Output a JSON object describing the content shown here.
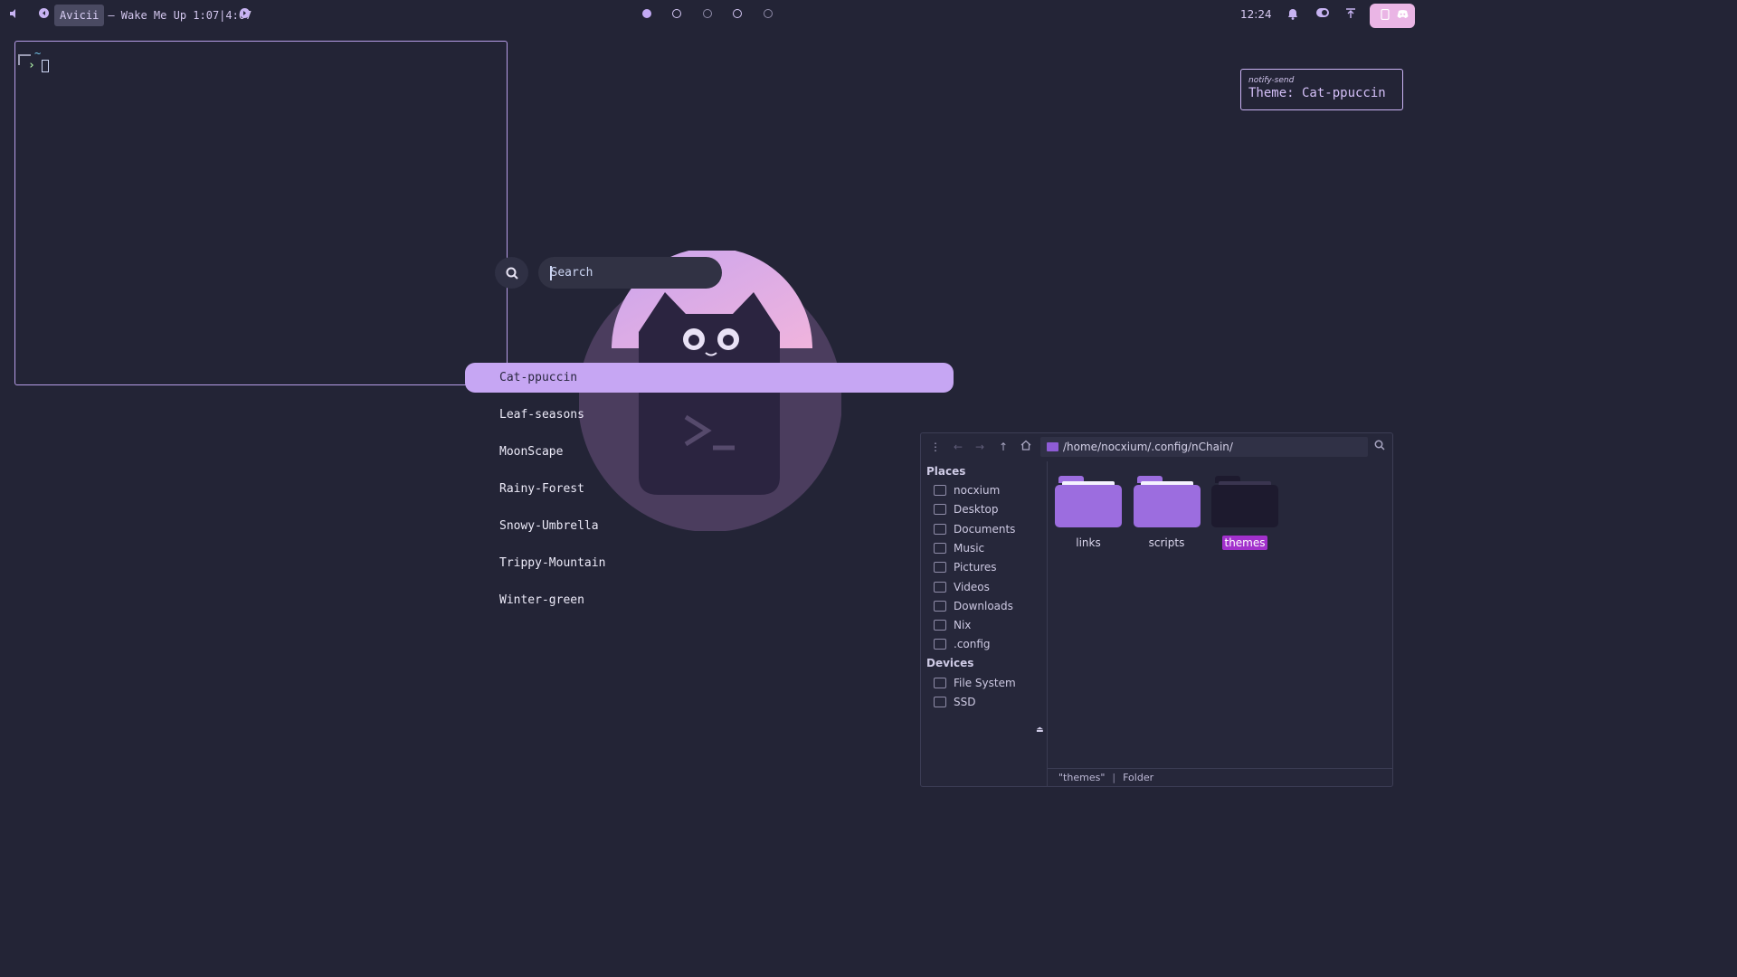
{
  "topbar": {
    "media": {
      "artist": "Avicii",
      "rest": "– Wake Me Up 1:07|4:07"
    },
    "workspaces": [
      {
        "active": true
      },
      {
        "active": false
      },
      {
        "active": false,
        "dim": true
      },
      {
        "active": false
      },
      {
        "active": false,
        "dim": true
      }
    ],
    "clock": "12:24",
    "icons": [
      "volume-icon",
      "prev-track-icon",
      "next-track-icon",
      "bell-icon",
      "toggle-icon",
      "upload-icon",
      "tray-icon"
    ]
  },
  "terminal": {
    "prompt_dir": "~"
  },
  "launcher": {
    "search": {
      "placeholder": "Search"
    },
    "themes": [
      "Cat-ppuccin",
      "Leaf-seasons",
      "MoonScape",
      "Rainy-Forest",
      "Snowy-Umbrella",
      "Trippy-Mountain",
      "Winter-green"
    ],
    "selected_index": 0
  },
  "notification": {
    "app": "notify-send",
    "body": "Theme: Cat-ppuccin"
  },
  "file_manager": {
    "path": "/home/nocxium/.config/nChain/",
    "places_heading": "Places",
    "places": [
      "nocxium",
      "Desktop",
      "Documents",
      "Music",
      "Pictures",
      "Videos",
      "Downloads",
      "Nix",
      ".config"
    ],
    "devices_heading": "Devices",
    "devices": [
      "File System",
      "SSD"
    ],
    "folders": [
      {
        "name": "links",
        "color": "#9c6ddf"
      },
      {
        "name": "scripts",
        "color": "#9c6ddf"
      },
      {
        "name": "themes",
        "color": "#1d1a2e"
      }
    ],
    "status": {
      "selection": "\"themes\"",
      "kind": "Folder"
    }
  },
  "colors": {
    "background": "#232436",
    "accent": "#c6a6f3",
    "selection": "#a231cc"
  }
}
